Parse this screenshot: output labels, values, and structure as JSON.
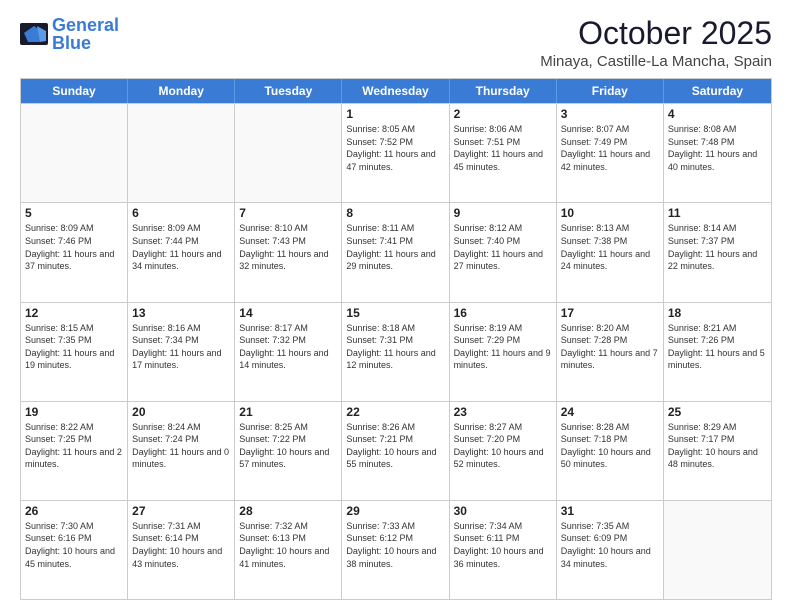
{
  "logo": {
    "text_general": "General",
    "text_blue": "Blue"
  },
  "header": {
    "month": "October 2025",
    "location": "Minaya, Castille-La Mancha, Spain"
  },
  "weekdays": [
    "Sunday",
    "Monday",
    "Tuesday",
    "Wednesday",
    "Thursday",
    "Friday",
    "Saturday"
  ],
  "weeks": [
    [
      {
        "day": "",
        "info": ""
      },
      {
        "day": "",
        "info": ""
      },
      {
        "day": "",
        "info": ""
      },
      {
        "day": "1",
        "info": "Sunrise: 8:05 AM\nSunset: 7:52 PM\nDaylight: 11 hours and 47 minutes."
      },
      {
        "day": "2",
        "info": "Sunrise: 8:06 AM\nSunset: 7:51 PM\nDaylight: 11 hours and 45 minutes."
      },
      {
        "day": "3",
        "info": "Sunrise: 8:07 AM\nSunset: 7:49 PM\nDaylight: 11 hours and 42 minutes."
      },
      {
        "day": "4",
        "info": "Sunrise: 8:08 AM\nSunset: 7:48 PM\nDaylight: 11 hours and 40 minutes."
      }
    ],
    [
      {
        "day": "5",
        "info": "Sunrise: 8:09 AM\nSunset: 7:46 PM\nDaylight: 11 hours and 37 minutes."
      },
      {
        "day": "6",
        "info": "Sunrise: 8:09 AM\nSunset: 7:44 PM\nDaylight: 11 hours and 34 minutes."
      },
      {
        "day": "7",
        "info": "Sunrise: 8:10 AM\nSunset: 7:43 PM\nDaylight: 11 hours and 32 minutes."
      },
      {
        "day": "8",
        "info": "Sunrise: 8:11 AM\nSunset: 7:41 PM\nDaylight: 11 hours and 29 minutes."
      },
      {
        "day": "9",
        "info": "Sunrise: 8:12 AM\nSunset: 7:40 PM\nDaylight: 11 hours and 27 minutes."
      },
      {
        "day": "10",
        "info": "Sunrise: 8:13 AM\nSunset: 7:38 PM\nDaylight: 11 hours and 24 minutes."
      },
      {
        "day": "11",
        "info": "Sunrise: 8:14 AM\nSunset: 7:37 PM\nDaylight: 11 hours and 22 minutes."
      }
    ],
    [
      {
        "day": "12",
        "info": "Sunrise: 8:15 AM\nSunset: 7:35 PM\nDaylight: 11 hours and 19 minutes."
      },
      {
        "day": "13",
        "info": "Sunrise: 8:16 AM\nSunset: 7:34 PM\nDaylight: 11 hours and 17 minutes."
      },
      {
        "day": "14",
        "info": "Sunrise: 8:17 AM\nSunset: 7:32 PM\nDaylight: 11 hours and 14 minutes."
      },
      {
        "day": "15",
        "info": "Sunrise: 8:18 AM\nSunset: 7:31 PM\nDaylight: 11 hours and 12 minutes."
      },
      {
        "day": "16",
        "info": "Sunrise: 8:19 AM\nSunset: 7:29 PM\nDaylight: 11 hours and 9 minutes."
      },
      {
        "day": "17",
        "info": "Sunrise: 8:20 AM\nSunset: 7:28 PM\nDaylight: 11 hours and 7 minutes."
      },
      {
        "day": "18",
        "info": "Sunrise: 8:21 AM\nSunset: 7:26 PM\nDaylight: 11 hours and 5 minutes."
      }
    ],
    [
      {
        "day": "19",
        "info": "Sunrise: 8:22 AM\nSunset: 7:25 PM\nDaylight: 11 hours and 2 minutes."
      },
      {
        "day": "20",
        "info": "Sunrise: 8:24 AM\nSunset: 7:24 PM\nDaylight: 11 hours and 0 minutes."
      },
      {
        "day": "21",
        "info": "Sunrise: 8:25 AM\nSunset: 7:22 PM\nDaylight: 10 hours and 57 minutes."
      },
      {
        "day": "22",
        "info": "Sunrise: 8:26 AM\nSunset: 7:21 PM\nDaylight: 10 hours and 55 minutes."
      },
      {
        "day": "23",
        "info": "Sunrise: 8:27 AM\nSunset: 7:20 PM\nDaylight: 10 hours and 52 minutes."
      },
      {
        "day": "24",
        "info": "Sunrise: 8:28 AM\nSunset: 7:18 PM\nDaylight: 10 hours and 50 minutes."
      },
      {
        "day": "25",
        "info": "Sunrise: 8:29 AM\nSunset: 7:17 PM\nDaylight: 10 hours and 48 minutes."
      }
    ],
    [
      {
        "day": "26",
        "info": "Sunrise: 7:30 AM\nSunset: 6:16 PM\nDaylight: 10 hours and 45 minutes."
      },
      {
        "day": "27",
        "info": "Sunrise: 7:31 AM\nSunset: 6:14 PM\nDaylight: 10 hours and 43 minutes."
      },
      {
        "day": "28",
        "info": "Sunrise: 7:32 AM\nSunset: 6:13 PM\nDaylight: 10 hours and 41 minutes."
      },
      {
        "day": "29",
        "info": "Sunrise: 7:33 AM\nSunset: 6:12 PM\nDaylight: 10 hours and 38 minutes."
      },
      {
        "day": "30",
        "info": "Sunrise: 7:34 AM\nSunset: 6:11 PM\nDaylight: 10 hours and 36 minutes."
      },
      {
        "day": "31",
        "info": "Sunrise: 7:35 AM\nSunset: 6:09 PM\nDaylight: 10 hours and 34 minutes."
      },
      {
        "day": "",
        "info": ""
      }
    ]
  ]
}
